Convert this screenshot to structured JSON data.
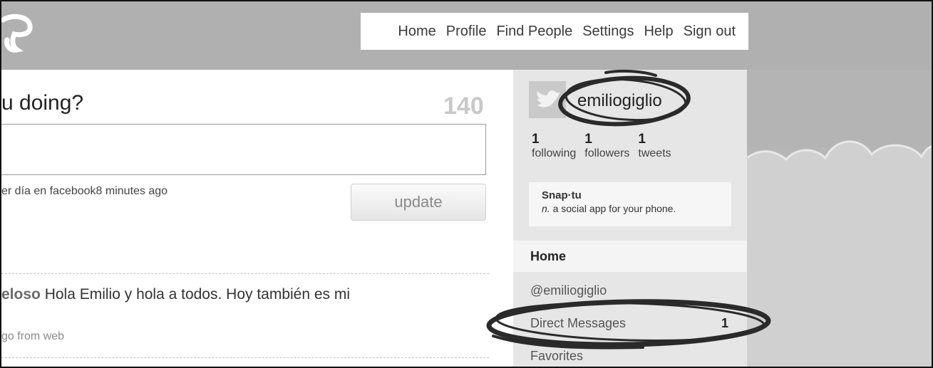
{
  "nav": {
    "items": [
      "Home",
      "Profile",
      "Find People",
      "Settings",
      "Help",
      "Sign out"
    ]
  },
  "status": {
    "question": "u doing?",
    "char_count": "140",
    "latest": "er día en facebook8 minutes ago",
    "update_label": "update"
  },
  "timeline": {
    "tweet_user": "eloso",
    "tweet_text": " Hola Emilio y hola a todos. Hoy también es mi",
    "tweet_meta": "go from web"
  },
  "profile": {
    "screen_name": "emiliogiglio",
    "stats": [
      {
        "value": "1",
        "label": "following"
      },
      {
        "value": "1",
        "label": "followers"
      },
      {
        "value": "1",
        "label": "tweets"
      }
    ]
  },
  "promo": {
    "title": "Snap·tu",
    "pos": "n.",
    "definition": " a social app for your phone."
  },
  "sidebar_menu": [
    {
      "label": "Home",
      "count": ""
    },
    {
      "label": "@emiliogiglio",
      "count": ""
    },
    {
      "label": "Direct Messages",
      "count": "1"
    },
    {
      "label": "Favorites",
      "count": ""
    }
  ],
  "icons": {
    "logo": "twitter-logo-t",
    "avatar": "default-bird-avatar"
  }
}
